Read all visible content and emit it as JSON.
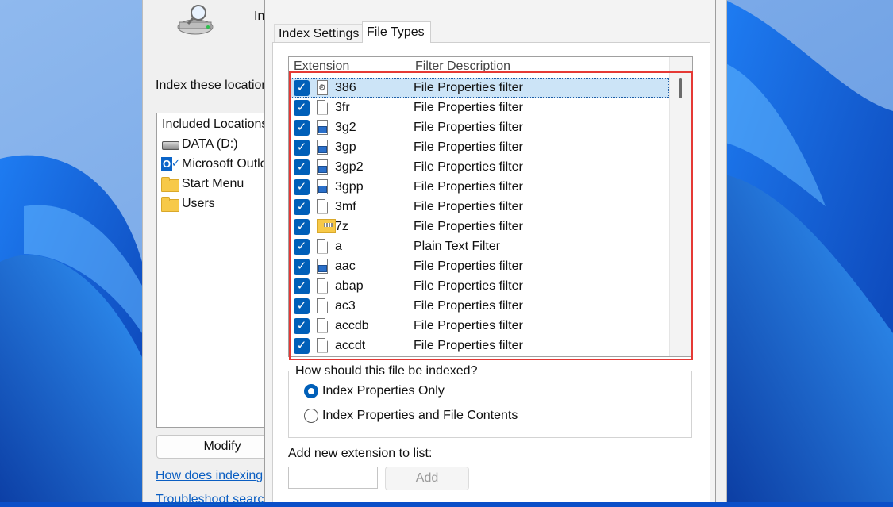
{
  "background_window": {
    "title_fragment": "In",
    "index_locations_label": "Index these location",
    "locations_header": "Included Locations",
    "locations": [
      {
        "label": "DATA (D:)",
        "icon": "drive-icon"
      },
      {
        "label": "Microsoft Outlo",
        "icon": "outlook-icon"
      },
      {
        "label": "Start Menu",
        "icon": "folder-icon"
      },
      {
        "label": "Users",
        "icon": "folder-icon"
      }
    ],
    "modify_label": "Modify",
    "link_how": "How does indexing",
    "link_troubleshoot": "Troubleshoot searc"
  },
  "dialog": {
    "tabs": {
      "index_settings": "Index Settings",
      "file_types": "File Types"
    },
    "columns": {
      "extension": "Extension",
      "filter": "Filter Description"
    },
    "rows": [
      {
        "ext": "386",
        "desc": "File Properties filter",
        "icon": "gear"
      },
      {
        "ext": "3fr",
        "desc": "File Properties filter",
        "icon": "doc"
      },
      {
        "ext": "3g2",
        "desc": "File Properties filter",
        "icon": "media"
      },
      {
        "ext": "3gp",
        "desc": "File Properties filter",
        "icon": "media"
      },
      {
        "ext": "3gp2",
        "desc": "File Properties filter",
        "icon": "media"
      },
      {
        "ext": "3gpp",
        "desc": "File Properties filter",
        "icon": "media"
      },
      {
        "ext": "3mf",
        "desc": "File Properties filter",
        "icon": "doc"
      },
      {
        "ext": "7z",
        "desc": "File Properties filter",
        "icon": "zip"
      },
      {
        "ext": "a",
        "desc": "Plain Text Filter",
        "icon": "doc"
      },
      {
        "ext": "aac",
        "desc": "File Properties filter",
        "icon": "media"
      },
      {
        "ext": "abap",
        "desc": "File Properties filter",
        "icon": "doc"
      },
      {
        "ext": "ac3",
        "desc": "File Properties filter",
        "icon": "doc"
      },
      {
        "ext": "accdb",
        "desc": "File Properties filter",
        "icon": "doc"
      },
      {
        "ext": "accdt",
        "desc": "File Properties filter",
        "icon": "doc"
      }
    ],
    "index_question": "How should this file be indexed?",
    "radio_properties": "Index Properties Only",
    "radio_contents": "Index Properties and File Contents",
    "add_extension_label": "Add new extension to list:",
    "add_button": "Add"
  },
  "colors": {
    "accent": "#005fb8",
    "highlight": "#e53935",
    "link": "#0a5ec2"
  }
}
